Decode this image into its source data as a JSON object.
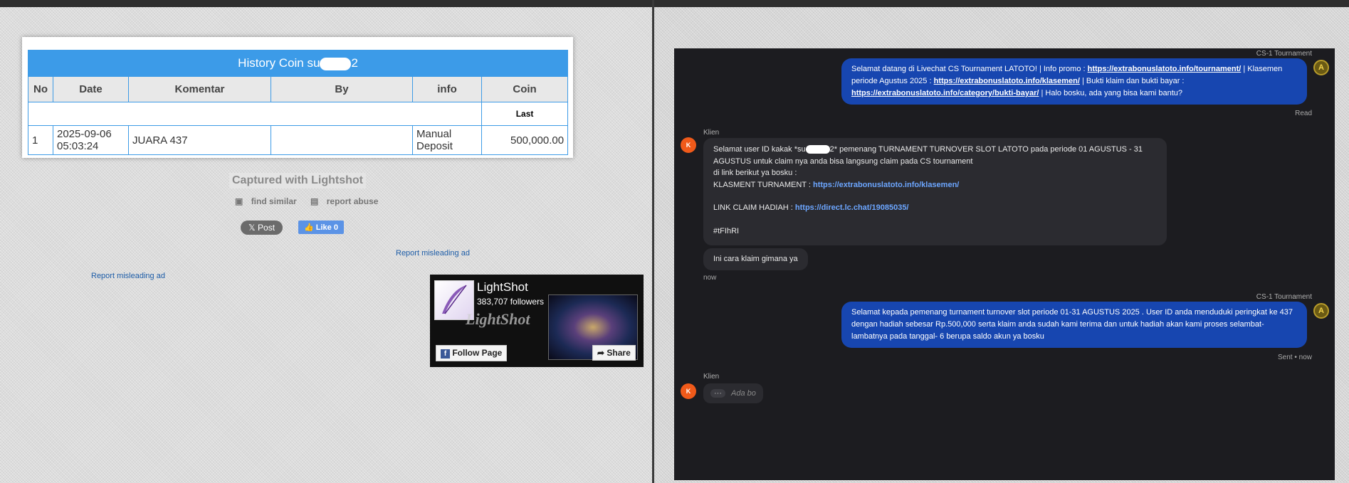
{
  "history": {
    "title": "History Coin su",
    "title_suffix": "2",
    "columns": [
      "No",
      "Date",
      "Komentar",
      "By",
      "info",
      "Coin"
    ],
    "last_label": "Last",
    "rows": [
      {
        "no": "1",
        "date_line1": "2025-09-06",
        "date_line2": "05:03:24",
        "komentar": "JUARA 437",
        "by": "",
        "info_line1": "Manual",
        "info_line2": "Deposit",
        "coin": "500,000.00"
      }
    ]
  },
  "lightshot": {
    "captured": "Captured with Lightshot",
    "find_similar": "find similar",
    "report_abuse": "report abuse",
    "post": "Post",
    "like": "Like 0",
    "report_ad_1": "Report misleading ad",
    "report_ad_2": "Report misleading ad",
    "page_name": "LightShot",
    "followers": "383,707 followers",
    "watermark": "LightShot",
    "follow": "Follow Page",
    "share": "Share"
  },
  "chat": {
    "agent_name_1": "CS-1 Tournament",
    "msg1_a": "Selamat datang di Livechat CS Tournament LATOTO! | Info promo : ",
    "msg1_link1": "https://extrabonuslatoto.info/tournament/",
    "msg1_b": " | Klasemen periode Agustus 2025 : ",
    "msg1_link2": "https://extrabonuslatoto.info/klasemen/",
    "msg1_c": " | Bukti klaim dan bukti bayar : ",
    "msg1_link3": "https://extrabonuslatoto.info/category/bukti-bayar/",
    "msg1_d": " | Halo bosku, ada yang bisa kami bantu?",
    "status_read": "Read",
    "client_name_1": "Klien",
    "client_initial": "K",
    "msg2_l1a": "Selamat user ID kakak *su",
    "msg2_l1b": "2* pemenang TURNAMENT TURNOVER SLOT LATOTO pada periode 01 AGUSTUS - 31",
    "msg2_l2": "AGUSTUS untuk claim nya anda bisa langsung claim pada CS tournament",
    "msg2_l3": "di link berikut ya bosku :",
    "msg2_l4a": "KLASMENT TURNAMENT : ",
    "msg2_l4link": "https://extrabonuslatoto.info/klasemen/",
    "msg2_l5a": "LINK CLAIM HADIAH : ",
    "msg2_l5link": "https://direct.lc.chat/19085035/",
    "msg2_l6": "#tFIhRI",
    "msg3": "Ini cara klaim gimana ya",
    "time_now": "now",
    "agent_name_2": "CS-1 Tournament",
    "msg4": "Selamat kepada pemenang turnament turnover slot periode 01-31 AGUSTUS 2025 . User ID anda menduduki peringkat ke 437 dengan hadiah sebesar Rp.500,000 serta klaim anda sudah kami terima dan untuk hadiah akan kami proses selambat-lambatnya pada tanggal- 6 berupa saldo akun ya bosku",
    "status_sent": "Sent • now",
    "client_name_2": "Klien",
    "typing_dots": "···",
    "typing_text": "Ada bo"
  },
  "colors": {
    "header_blue": "#3c9be8",
    "agent_bubble": "#1746b0",
    "client_avatar": "#f05a1a",
    "coin_green": "#1a8a1a"
  }
}
